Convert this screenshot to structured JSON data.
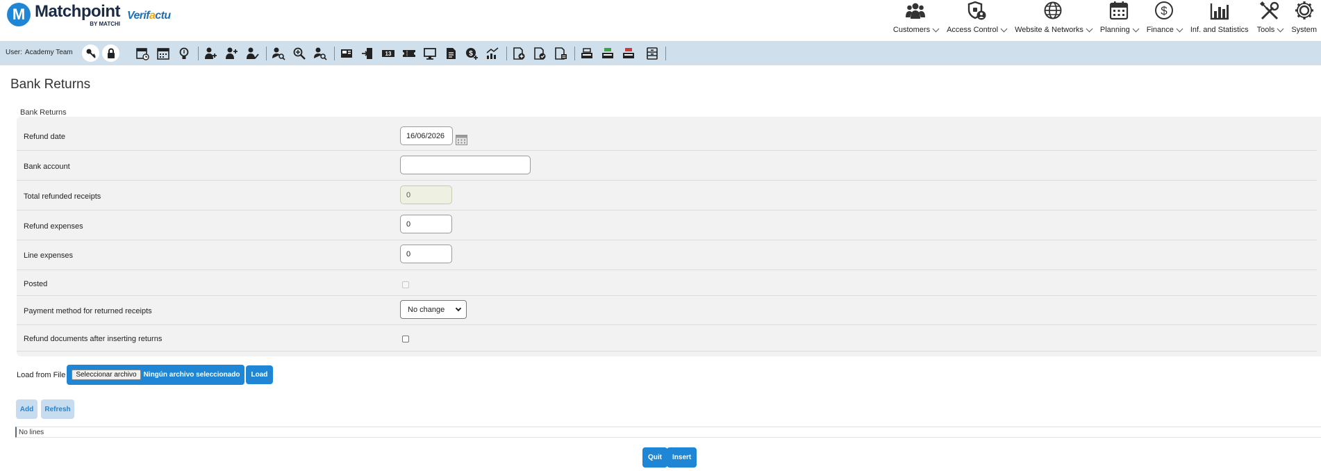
{
  "brand": {
    "logo_letter": "M",
    "name": "Matchpoint",
    "byline": "BY MATCHI",
    "partner_prefix": "Verif",
    "partner_dot": "a",
    "partner_suffix": "ctu",
    "accent_color": "#1f86d6"
  },
  "menu": [
    {
      "label": "Customers",
      "icon": "customers-icon"
    },
    {
      "label": "Access Control",
      "icon": "access-control-icon"
    },
    {
      "label": "Website & Networks",
      "icon": "globe-icon"
    },
    {
      "label": "Planning",
      "icon": "calendar-icon"
    },
    {
      "label": "Finance",
      "icon": "dollar-icon"
    },
    {
      "label": "Inf. and Statistics",
      "icon": "bar-chart-icon"
    },
    {
      "label": "Tools",
      "icon": "tools-icon"
    },
    {
      "label": "System",
      "icon": "gear-icon"
    }
  ],
  "toolbar": {
    "user_label": "User:",
    "user_name": "Academy Team"
  },
  "page": {
    "title": "Bank Returns",
    "group_label": "Bank Returns"
  },
  "form": {
    "refund_date": {
      "label": "Refund date",
      "value": "16/06/2026"
    },
    "bank_account": {
      "label": "Bank account",
      "value": ""
    },
    "total_refunded": {
      "label": "Total refunded receipts",
      "value": "0"
    },
    "refund_expenses": {
      "label": "Refund expenses",
      "value": "0"
    },
    "line_expenses": {
      "label": "Line expenses",
      "value": "0"
    },
    "posted": {
      "label": "Posted",
      "checked": false
    },
    "payment_method": {
      "label": "Payment method for returned receipts",
      "value": "No change"
    },
    "refund_docs": {
      "label": "Refund documents after inserting returns",
      "checked": false
    }
  },
  "load": {
    "label": "Load from File",
    "file_button": "Seleccionar archivo",
    "file_status": "Ningún archivo seleccionado",
    "load_button": "Load"
  },
  "actions": {
    "add": "Add",
    "refresh": "Refresh",
    "quit": "Quit",
    "insert": "Insert"
  },
  "lines": {
    "empty_text": "No lines"
  }
}
